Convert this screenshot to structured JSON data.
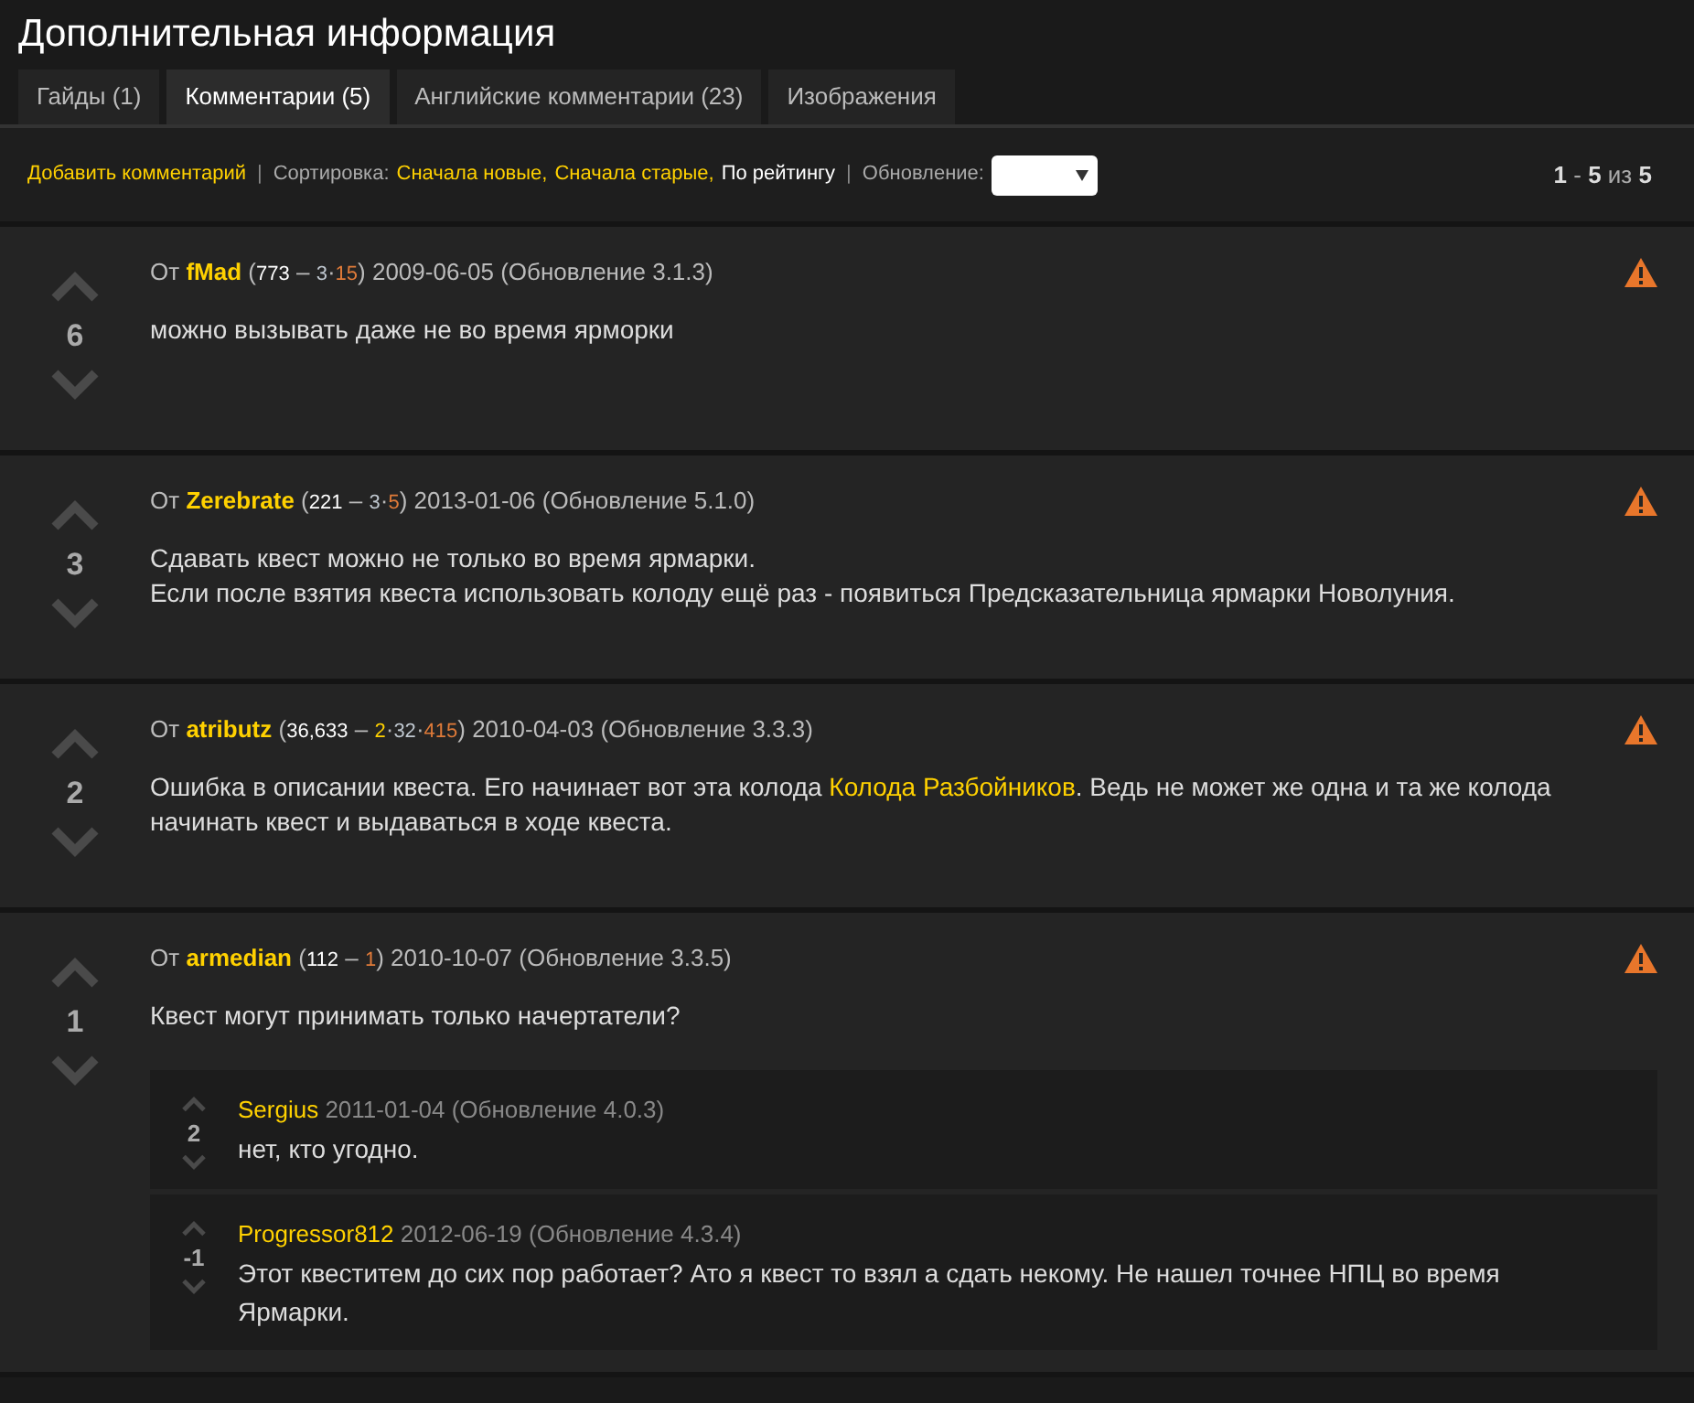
{
  "title": "Дополнительная информация",
  "tabs": [
    {
      "label": "Гайды (1)",
      "selected": false
    },
    {
      "label": "Комментарии (5)",
      "selected": true
    },
    {
      "label": "Английские комментарии (23)",
      "selected": false
    },
    {
      "label": "Изображения",
      "selected": false
    }
  ],
  "toolbar": [
    {
      "kind": "link",
      "text": "Добавить комментарий"
    },
    {
      "kind": "separator",
      "text": "|"
    },
    {
      "kind": "label",
      "text": "Сортировка:"
    },
    {
      "kind": "sort",
      "text": "Сначала новые,",
      "selected": false
    },
    {
      "kind": "sort",
      "text": "Сначала старые,",
      "selected": false
    },
    {
      "kind": "sort",
      "text": "По рейтингу",
      "selected": true
    },
    {
      "kind": "separator",
      "text": "|"
    },
    {
      "kind": "label",
      "text": "Обновление:"
    },
    {
      "kind": "dropdown"
    }
  ],
  "pager": [
    {
      "text": "1",
      "kind": "bold"
    },
    {
      "text": " - "
    },
    {
      "text": "5",
      "kind": "bold"
    },
    {
      "text": " из "
    },
    {
      "text": "5",
      "kind": "bold"
    }
  ],
  "comments": [
    {
      "score": "6",
      "meta": [
        {
          "text": "От "
        },
        {
          "text": "fMad",
          "kind": "author"
        },
        {
          "text": " ("
        },
        {
          "text": "773",
          "kind": "reputation"
        },
        {
          "text": " – "
        },
        {
          "text": "3",
          "kind": "silver"
        },
        {
          "text": "·"
        },
        {
          "text": "15",
          "kind": "bronze"
        },
        {
          "text": ") 2009-06-05 (Обновление 3.1.3)"
        }
      ],
      "body": [
        [
          {
            "text": "можно вызывать даже не во время ярморки"
          }
        ]
      ]
    },
    {
      "score": "3",
      "meta": [
        {
          "text": "От "
        },
        {
          "text": "Zerebrate",
          "kind": "author"
        },
        {
          "text": " ("
        },
        {
          "text": "221",
          "kind": "reputation"
        },
        {
          "text": " – "
        },
        {
          "text": "3",
          "kind": "silver"
        },
        {
          "text": "·"
        },
        {
          "text": "5",
          "kind": "bronze"
        },
        {
          "text": ") 2013-01-06 (Обновление 5.1.0)"
        }
      ],
      "body": [
        [
          {
            "text": "Сдавать квест можно не только во время ярмарки."
          }
        ],
        [
          {
            "text": "Если после взятия квеста использовать колоду ещё раз - появиться Предсказательница ярмарки Новолуния."
          }
        ]
      ]
    },
    {
      "score": "2",
      "meta": [
        {
          "text": "От "
        },
        {
          "text": "atributz",
          "kind": "author"
        },
        {
          "text": " ("
        },
        {
          "text": "36,633",
          "kind": "reputation"
        },
        {
          "text": " – "
        },
        {
          "text": "2",
          "kind": "gold"
        },
        {
          "text": "·"
        },
        {
          "text": "32",
          "kind": "silver"
        },
        {
          "text": "·"
        },
        {
          "text": "415",
          "kind": "bronze"
        },
        {
          "text": ") 2010-04-03 (Обновление 3.3.3)"
        }
      ],
      "body": [
        [
          {
            "text": "Ошибка в описании квеста. Его начинает вот эта колода "
          },
          {
            "text": "Колода Разбойников",
            "kind": "link"
          },
          {
            "text": ". Ведь не может же одна и та же колода начинать квест и выдаваться в ходе квеста."
          }
        ]
      ]
    },
    {
      "score": "1",
      "meta": [
        {
          "text": "От "
        },
        {
          "text": "armedian",
          "kind": "author"
        },
        {
          "text": " ("
        },
        {
          "text": "112",
          "kind": "reputation"
        },
        {
          "text": " – "
        },
        {
          "text": "1",
          "kind": "bronze"
        },
        {
          "text": ") 2010-10-07 (Обновление 3.3.5)"
        }
      ],
      "body": [
        [
          {
            "text": "Квест могут принимать только начертатели?"
          }
        ]
      ],
      "replies": [
        {
          "score": "2",
          "author": "Sergius",
          "date": "2011-01-04 (Обновление 4.0.3)",
          "body": "нет, кто угодно."
        },
        {
          "score": "-1",
          "author": "Progressor812",
          "date": "2012-06-19 (Обновление 4.3.4)",
          "body": "Этот квеститем до сих пор работает? Ато я квест то взял а сдать некому. Не нашел точнее НПЦ во время Ярмарки."
        }
      ]
    }
  ]
}
